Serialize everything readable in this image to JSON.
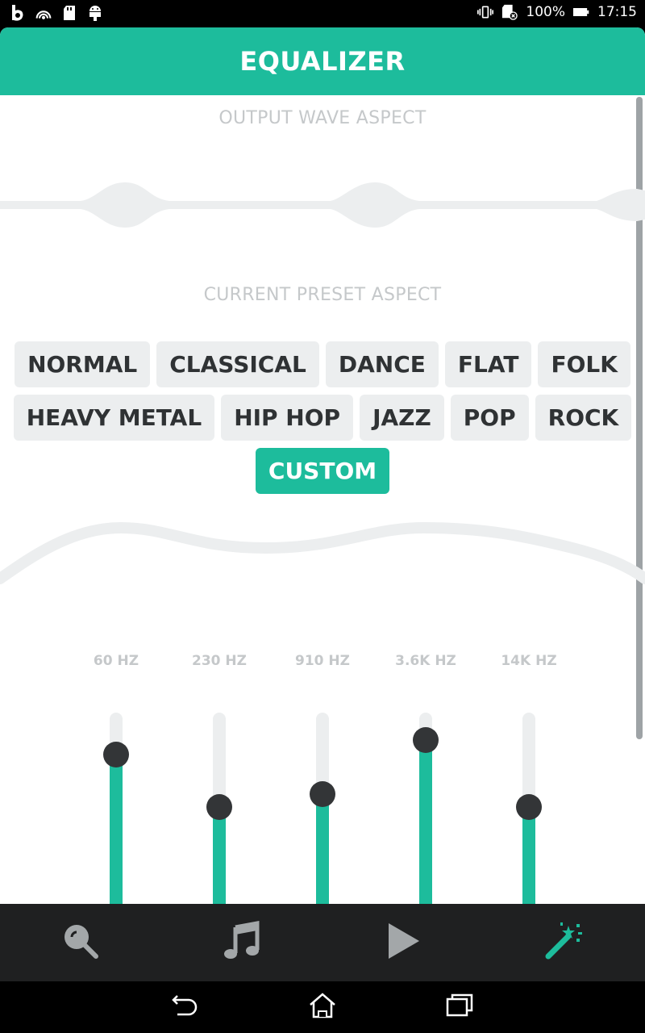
{
  "status_bar": {
    "battery": "100%",
    "time": "17:15",
    "icons_left": [
      "b-app-icon",
      "broadcast-icon",
      "sd-card-icon",
      "android-icon"
    ],
    "icons_right": [
      "vibrate-icon",
      "sd-card-error-icon",
      "battery-icon"
    ]
  },
  "header": {
    "title": "EQUALIZER"
  },
  "output_wave": {
    "title": "OUTPUT WAVE ASPECT"
  },
  "preset_section": {
    "title": "CURRENT PRESET ASPECT",
    "rows": [
      [
        "NORMAL",
        "CLASSICAL",
        "DANCE",
        "FLAT",
        "FOLK"
      ],
      [
        "HEAVY METAL",
        "HIP HOP",
        "JAZZ",
        "POP",
        "ROCK"
      ],
      [
        "CUSTOM"
      ]
    ],
    "selected": "CUSTOM"
  },
  "bands": [
    {
      "label": "60 HZ",
      "level": 0.8
    },
    {
      "label": "230 HZ",
      "level": 0.55
    },
    {
      "label": "910 HZ",
      "level": 0.61
    },
    {
      "label": "3.6K HZ",
      "level": 0.87
    },
    {
      "label": "14K HZ",
      "level": 0.55
    }
  ],
  "bottom_nav": {
    "items": [
      "search-icon",
      "music-note-icon",
      "play-icon",
      "magic-wand-icon"
    ],
    "active": "magic-wand-icon"
  },
  "system_nav": [
    "back-icon",
    "home-icon",
    "recents-icon"
  ],
  "colors": {
    "accent": "#1dbc9c",
    "chip_bg": "#eceeef",
    "knob": "#333537",
    "nav_bg": "#1f2021"
  }
}
